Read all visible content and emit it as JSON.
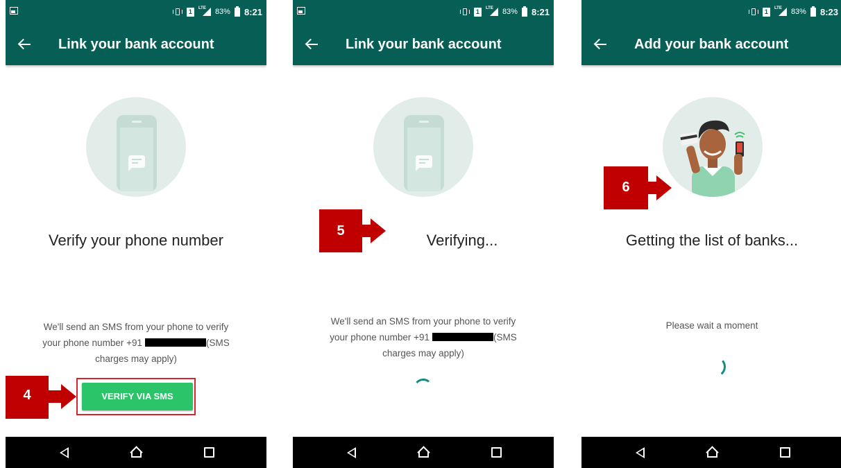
{
  "screens": [
    {
      "status_bar": {
        "battery": "83%",
        "time": "8:21"
      },
      "title": "Link your bank account",
      "heading": "Verify your phone number",
      "info_line1": "We'll send an SMS from your phone to verify",
      "info_line2_prefix": "your phone number +91",
      "info_line2_suffix": "(SMS",
      "info_line3": "charges may apply)",
      "button_label": "VERIFY VIA SMS",
      "step_number": "4"
    },
    {
      "status_bar": {
        "battery": "83%",
        "time": "8:21"
      },
      "title": "Link your bank account",
      "heading": "Verifying...",
      "info_line1": "We'll send an SMS from your phone to verify",
      "info_line2_prefix": "your phone number +91",
      "info_line2_suffix": "(SMS",
      "info_line3": "charges may apply)",
      "step_number": "5"
    },
    {
      "status_bar": {
        "battery": "83%",
        "time": "8:23"
      },
      "title": "Add your bank account",
      "heading": "Getting the list of banks...",
      "info_line1": "Please wait a moment",
      "step_number": "6"
    }
  ],
  "colors": {
    "toolbar": "#075e54",
    "button": "#2bc469",
    "annotation": "#c00000",
    "spinner": "#128c7e"
  },
  "icons": [
    "back-arrow-icon",
    "vibrate-icon",
    "sim-icon",
    "signal-icon",
    "battery-icon",
    "nav-back-icon",
    "nav-home-icon",
    "nav-recent-icon"
  ]
}
